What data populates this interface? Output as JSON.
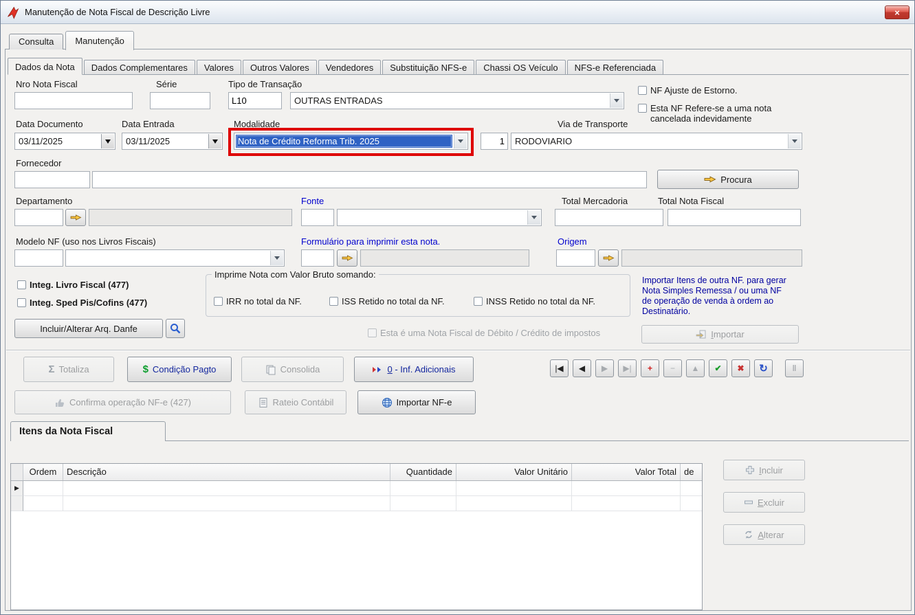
{
  "window": {
    "title": "Manutenção de Nota Fiscal de Descrição Livre"
  },
  "tabs": {
    "main": [
      {
        "label": "Consulta"
      },
      {
        "label": "Manutenção"
      }
    ],
    "sub": [
      {
        "label": "Dados da Nota"
      },
      {
        "label": "Dados Complementares"
      },
      {
        "label": "Valores"
      },
      {
        "label": "Outros Valores"
      },
      {
        "label": "Vendedores"
      },
      {
        "label": "Substituição NFS-e"
      },
      {
        "label": "Chassi OS Veículo"
      },
      {
        "label": "NFS-e Referenciada"
      }
    ]
  },
  "fields": {
    "nro": {
      "label": "Nro Nota Fiscal",
      "value": ""
    },
    "serie": {
      "label": "Série",
      "value": ""
    },
    "tipo": {
      "label": "Tipo de Transação",
      "code": "L10",
      "value": "OUTRAS ENTRADAS"
    },
    "chk_estorno": "NF Ajuste de Estorno.",
    "chk_cancelada": "Esta NF Refere-se a uma nota cancelada indevidamente",
    "data_documento": {
      "label": "Data Documento",
      "value": "03/11/2025"
    },
    "data_entrada": {
      "label": "Data Entrada",
      "value": "03/11/2025"
    },
    "modalidade": {
      "label": "Modalidade",
      "value": "Nota de Crédito Reforma Trib. 2025"
    },
    "via": {
      "label": "Via de Transporte",
      "code": "1",
      "value": "RODOVIARIO"
    },
    "fornecedor": {
      "label": "Fornecedor",
      "code": "",
      "value": ""
    },
    "procura": "Procura",
    "departamento": {
      "label": "Departamento",
      "code": "",
      "value": ""
    },
    "fonte": {
      "label": "Fonte",
      "code": "",
      "value": ""
    },
    "total_mercadoria": {
      "label": "Total Mercadoria",
      "value": ""
    },
    "total_nota_fiscal": {
      "label": "Total Nota Fiscal",
      "value": ""
    },
    "modelo": {
      "label": "Modelo NF (uso nos Livros Fiscais)",
      "code": "",
      "value": ""
    },
    "formulario": {
      "label": "Formulário para imprimir esta nota.",
      "code": "",
      "value": ""
    },
    "origem": {
      "label": "Origem",
      "code": "",
      "value": ""
    },
    "chk_livro": "Integ. Livro Fiscal (477)",
    "chk_sped": "Integ. Sped Pis/Cofins (477)",
    "imprime": {
      "title": "Imprime Nota com Valor Bruto somando:",
      "irr": "IRR no total da NF.",
      "iss": "ISS Retido no total da NF.",
      "inss": "INSS Retido no total da NF."
    },
    "hint_lines": [
      "Importar Itens de outra NF. para gerar",
      "Nota Simples Remessa / ou uma NF",
      "de operação de venda à ordem ao",
      "Destinatário."
    ],
    "danfe": "Incluir/Alterar Arq. Danfe",
    "chk_debito": "Esta é uma Nota Fiscal de Débito / Crédito de impostos",
    "importar": "Importar"
  },
  "toolbar": {
    "totaliza": "Totaliza",
    "condicao": "Condição Pagto",
    "consolida": "Consolida",
    "inf_adicionais": "0 - Inf. Adicionais",
    "confirma": "Confirma operação NF-e (427)",
    "rateio": "Rateio Contábil",
    "importar_nfe": "Importar NF-e"
  },
  "items": {
    "title": "Itens da Nota Fiscal",
    "columns": [
      "Ordem",
      "Descrição",
      "Quantidade",
      "Valor Unitário",
      "Valor Total",
      "de"
    ],
    "rows": [],
    "buttons": {
      "incluir": "Incluir",
      "excluir": "Excluir",
      "alterar": "Alterar"
    }
  },
  "icons": {
    "close": "×",
    "sigma": "Σ",
    "dollar": "$",
    "row_pointer": "▶",
    "nav": {
      "first": "|◀",
      "prior": "◀",
      "next": "▶",
      "last": "▶|",
      "insert": "+",
      "delete": "−",
      "edit": "▲",
      "post": "✔",
      "cancel": "✖",
      "refresh": "↻",
      "hold": "‖"
    }
  },
  "colors": {
    "annotation": "#DE0000",
    "selection": "#2F62C4",
    "label_blue": "#0000CD"
  }
}
